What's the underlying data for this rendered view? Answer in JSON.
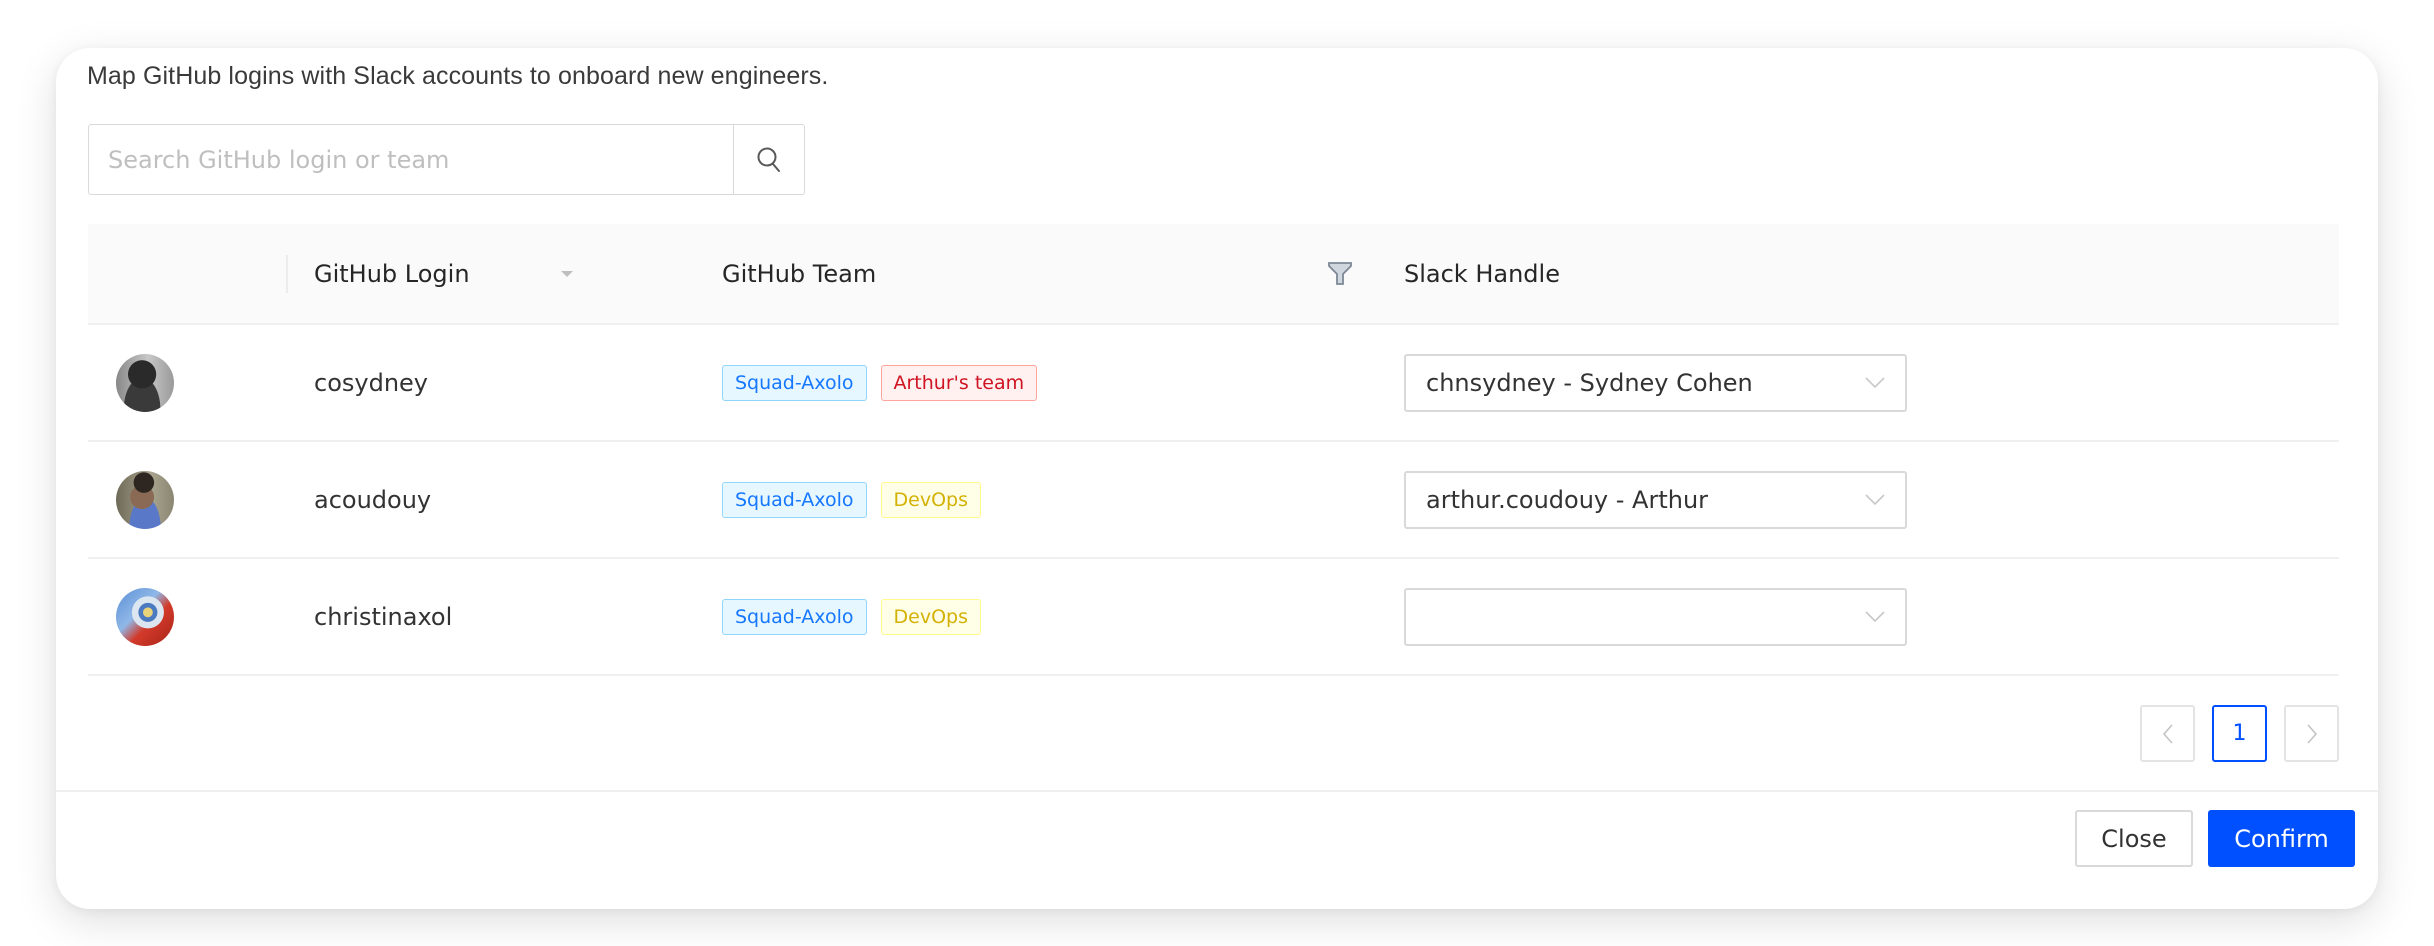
{
  "description": "Map GitHub logins with Slack accounts to onboard new engineers.",
  "search": {
    "placeholder": "Search GitHub login or team",
    "value": "",
    "button_icon": "search-icon"
  },
  "table": {
    "columns": [
      {
        "key": "avatar",
        "label": ""
      },
      {
        "key": "login",
        "label": "GitHub Login",
        "icon": "sort-caret-down-icon"
      },
      {
        "key": "team",
        "label": "GitHub Team",
        "icon": "filter-icon"
      },
      {
        "key": "slack",
        "label": "Slack Handle"
      }
    ],
    "rows": [
      {
        "avatar": "grayscale-portrait",
        "login": "cosydney",
        "teams": [
          {
            "label": "Squad-Axolo",
            "color": "blue"
          },
          {
            "label": "Arthur's team",
            "color": "red"
          }
        ],
        "slack": "chnsydney - Sydney Cohen"
      },
      {
        "avatar": "portrait",
        "login": "acoudouy",
        "teams": [
          {
            "label": "Squad-Axolo",
            "color": "blue"
          },
          {
            "label": "DevOps",
            "color": "gold"
          }
        ],
        "slack": "arthur.coudouy - Arthur"
      },
      {
        "avatar": "cartoon",
        "login": "christinaxol",
        "teams": [
          {
            "label": "Squad-Axolo",
            "color": "blue"
          },
          {
            "label": "DevOps",
            "color": "gold"
          }
        ],
        "slack": ""
      }
    ]
  },
  "tag_colors": {
    "blue": {
      "bg": "#e6f7ff",
      "border": "#91d5ff",
      "text": "#1677ff"
    },
    "red": {
      "bg": "#fff1f0",
      "border": "#ffa39e",
      "text": "#cf1322"
    },
    "gold": {
      "bg": "#feffe6",
      "border": "#fffb8f",
      "text": "#d4b106"
    }
  },
  "pagination": {
    "prev_icon": "chevron-left-icon",
    "current_page": "1",
    "next_icon": "chevron-right-icon"
  },
  "footer": {
    "close_label": "Close",
    "confirm_label": "Confirm"
  },
  "colors": {
    "primary": "#0050ff"
  }
}
